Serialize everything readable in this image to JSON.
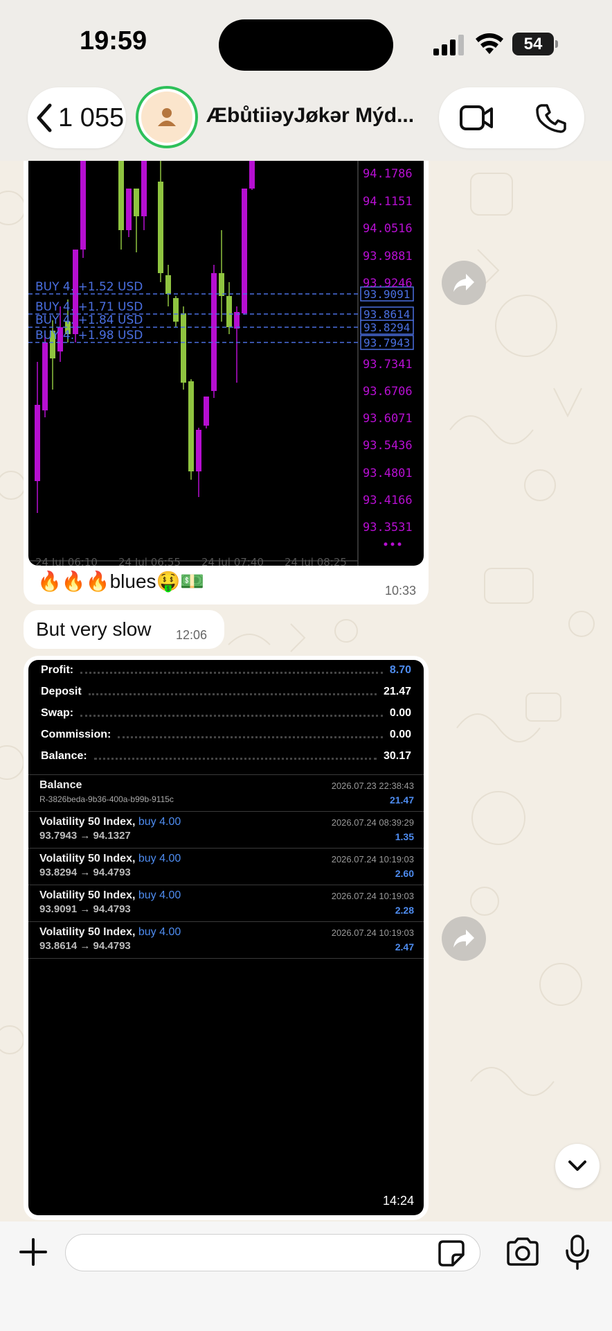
{
  "status_bar": {
    "time": "19:59",
    "battery": "54"
  },
  "header": {
    "back_count": "1 055",
    "contact_name": "ÆbůtiiəyJøkər Mýd..."
  },
  "messages": {
    "chart_caption": "🔥🔥🔥blues🤑💵",
    "chart_time": "10:33",
    "text_message": "But very slow",
    "text_time": "12:06",
    "history_time": "14:24"
  },
  "chart": {
    "price_labels": [
      "94.1786",
      "94.1151",
      "94.0516",
      "93.9881",
      "93.9246",
      "93.7341",
      "93.6706",
      "93.6071",
      "93.5436",
      "93.4801",
      "93.4166",
      "93.3531"
    ],
    "order_lines": [
      "BUY 4.    +1.52 USD",
      "BUY 4.    +1.71 USD",
      "BUY 4.    +1.84 USD",
      "BUY 4.    +1.98 USD"
    ],
    "order_prices": [
      "93.9091",
      "93.8614",
      "93.8294",
      "93.7943"
    ],
    "time_axis": [
      "24 Jul 06:10",
      "24 Jul 06:55",
      "24 Jul 07:40",
      "24 Jul 08:25"
    ],
    "colors": {
      "bull": "#8fc440",
      "bear": "#b60fd1",
      "order": "#4a6fe0"
    }
  },
  "summary": [
    {
      "label": "Profit:",
      "value": "8.70",
      "highlight": true
    },
    {
      "label": "Deposit",
      "value": "21.47"
    },
    {
      "label": "Swap:",
      "value": "0.00"
    },
    {
      "label": "Commission:",
      "value": "0.00"
    },
    {
      "label": "Balance:",
      "value": "30.17"
    }
  ],
  "deals": [
    {
      "title": "Balance",
      "sub": "R-3826beda-9b36-400a-b99b-9115c",
      "date": "2026.07.23 22:38:43",
      "amount": "21.47"
    },
    {
      "title": "Volatility 50 Index,",
      "side": "buy 4.00",
      "prices": "93.7943 → 94.1327",
      "date": "2026.07.24 08:39:29",
      "amount": "1.35"
    },
    {
      "title": "Volatility 50 Index,",
      "side": "buy 4.00",
      "prices": "93.8294 → 94.4793",
      "date": "2026.07.24 10:19:03",
      "amount": "2.60"
    },
    {
      "title": "Volatility 50 Index,",
      "side": "buy 4.00",
      "prices": "93.9091 → 94.4793",
      "date": "2026.07.24 10:19:03",
      "amount": "2.28"
    },
    {
      "title": "Volatility 50 Index,",
      "side": "buy 4.00",
      "prices": "93.8614 → 94.4793",
      "date": "2026.07.24 10:19:03",
      "amount": "2.47"
    }
  ],
  "input": {
    "placeholder": ""
  }
}
